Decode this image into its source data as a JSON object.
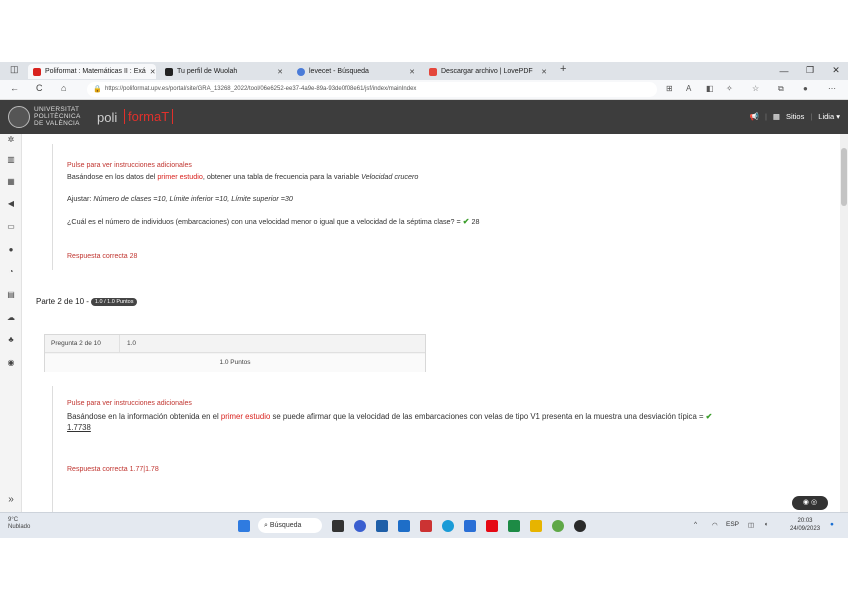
{
  "browser": {
    "tabs": [
      {
        "label": "Poliformat : Matemáticas II : Exá"
      },
      {
        "label": "Tu perfil de Wuolah"
      },
      {
        "label": "levecet - Búsqueda"
      },
      {
        "label": "Descargar archivo | LovePDF"
      }
    ],
    "new_tab": "+",
    "window": {
      "minimize": "—",
      "maximize": "❐",
      "close": "✕"
    },
    "url": "https://poliformat.upv.es/portal/site/GRA_13268_2022/tool/06e6252-ee37-4a9e-89a-93de0f08e61/jsf/index/mainIndex",
    "nav": {
      "back": "←",
      "refresh": "C",
      "home": "⌂"
    }
  },
  "site": {
    "university_lines": [
      "UNIVERSITAT",
      "POLITÈCNICA",
      "DE VALÈNCIA"
    ],
    "logo_prefix": "poli",
    "logo_suffix": "formaT",
    "sites_label": "Sitios",
    "user_label": "Lidia ▾"
  },
  "part1": {
    "hint": "Pulse para ver instrucciones adicionales",
    "text_before": "Basándose en los datos del ",
    "text_bold": "primer estudio",
    "text_after": ", obtener una tabla de frecuencia para la variable ",
    "text_var": "Velocidad crucero",
    "adjust_label": "Ajustar: ",
    "adjust_values": "Número de clases =10, Límite inferior =10, Límite superior =30",
    "question": "¿Cuál es el número de individuos (embarcaciones) con una velocidad menor o igual que a velocidad de la séptima clase? = ",
    "student_answer": "28",
    "correct_answer": "Respuesta correcta 28"
  },
  "part2": {
    "title": "Parte 2 de 10 - ",
    "badge": "1.0 / 1.0 Puntos",
    "table_question": "Pregunta 2 de 10",
    "table_score_cell": "1.0",
    "table_points": "1.0 Puntos",
    "hint": "Pulse para ver instrucciones adicionales",
    "text_before": "Basándose en la información obtenida en el ",
    "text_bold": "primer estudio",
    "text_after": " se puede afirmar que la velocidad de las embarcaciones con velas de tipo V1 presenta en la muestra una desviación típica = ",
    "student_answer": "1.7738",
    "correct_answer": "Respuesta correcta 1.77|1.78"
  },
  "taskbar": {
    "weather_temp": "9°C",
    "weather_desc": "Nublado",
    "search_label": "Búsqueda",
    "lang": "ESP",
    "time": "20:03",
    "date": "24/09/2023"
  },
  "colors": {
    "accent": "#e2302b",
    "header_bg": "#3d3d3d",
    "ok": "#3a9d2a"
  }
}
